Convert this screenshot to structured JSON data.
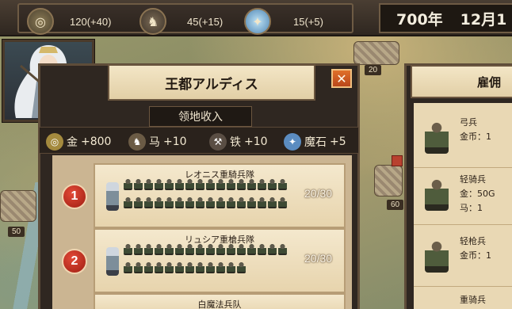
{
  "resources": [
    {
      "icon": "gold-coin-icon",
      "value": "120(+40)"
    },
    {
      "icon": "horse-icon",
      "value": "45(+15)"
    },
    {
      "icon": "magic-stone-icon",
      "value": "15(+5)"
    }
  ],
  "date": {
    "year": "700年",
    "month_day": "12月1"
  },
  "map": {
    "badge_top": "20",
    "badge_left": "50",
    "badge_right": "60"
  },
  "panel": {
    "title": "王都アルディス",
    "close_label": "✕",
    "income_title": "领地收入",
    "income": [
      {
        "icon": "gold-coin-icon",
        "label": "金",
        "value": "+800"
      },
      {
        "icon": "horse-icon",
        "label": "马",
        "value": "+10"
      },
      {
        "icon": "iron-icon",
        "label": "铁",
        "value": "+10"
      },
      {
        "icon": "magic-stone-icon",
        "label": "魔石",
        "value": "+5"
      }
    ],
    "units": [
      {
        "number": "1",
        "name": "レオニス重騎兵隊",
        "count": "20/30"
      },
      {
        "number": "2",
        "name": "リュシア重槍兵隊",
        "count": "20/30"
      },
      {
        "number": "",
        "name": "白魔法兵队",
        "count": ""
      }
    ]
  },
  "hire": {
    "title": "雇佣",
    "entries": [
      {
        "name": "弓兵",
        "cost": "金币：1",
        "cost2": ""
      },
      {
        "name": "轻骑兵",
        "cost": "金：50G",
        "cost2": "马：1"
      },
      {
        "name": "轻枪兵",
        "cost": "金币：1",
        "cost2": ""
      },
      {
        "name": "重骑兵",
        "cost": "",
        "cost2": ""
      }
    ]
  },
  "colors": {
    "accent": "#e0702a",
    "unit_number": "#c8321f",
    "panel_frame": "#5e4c39",
    "parchment": "#f3e6c6"
  }
}
